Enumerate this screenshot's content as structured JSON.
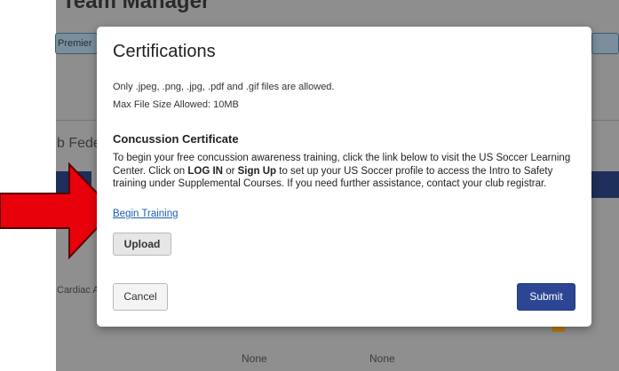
{
  "background": {
    "app_title": "Team Manager",
    "premier_tab": "Premier",
    "section_partial": "b Fede",
    "row_label_partial": "Cardiac A",
    "cell_none_1": "None",
    "cell_none_2": "None"
  },
  "modal": {
    "title": "Certifications",
    "allowed_types": "Only .jpeg, .png, .jpg, .pdf and .gif files are allowed.",
    "max_size": "Max File Size Allowed: 10MB",
    "section_title": "Concussion Certificate",
    "desc_part1": "To begin your free concussion awareness training, click the link below to visit the US Soccer Learning Center. Click on ",
    "desc_login": "LOG IN",
    "desc_part2": " or ",
    "desc_signup": "Sign Up",
    "desc_part3": " to set up your US Soccer profile to access the Intro to Safety training under Supplemental Courses. If you need further assistance, contact your club registrar.",
    "begin_training_link": "Begin Training",
    "upload_label": "Upload",
    "cancel_label": "Cancel",
    "submit_label": "Submit"
  },
  "colors": {
    "overlay": "#8e8e8e",
    "primary_button": "#2c4694",
    "link": "#1a5fb4",
    "arrow": "#e8000b"
  },
  "icons": {
    "annotation_arrow": "red-arrow-icon"
  }
}
